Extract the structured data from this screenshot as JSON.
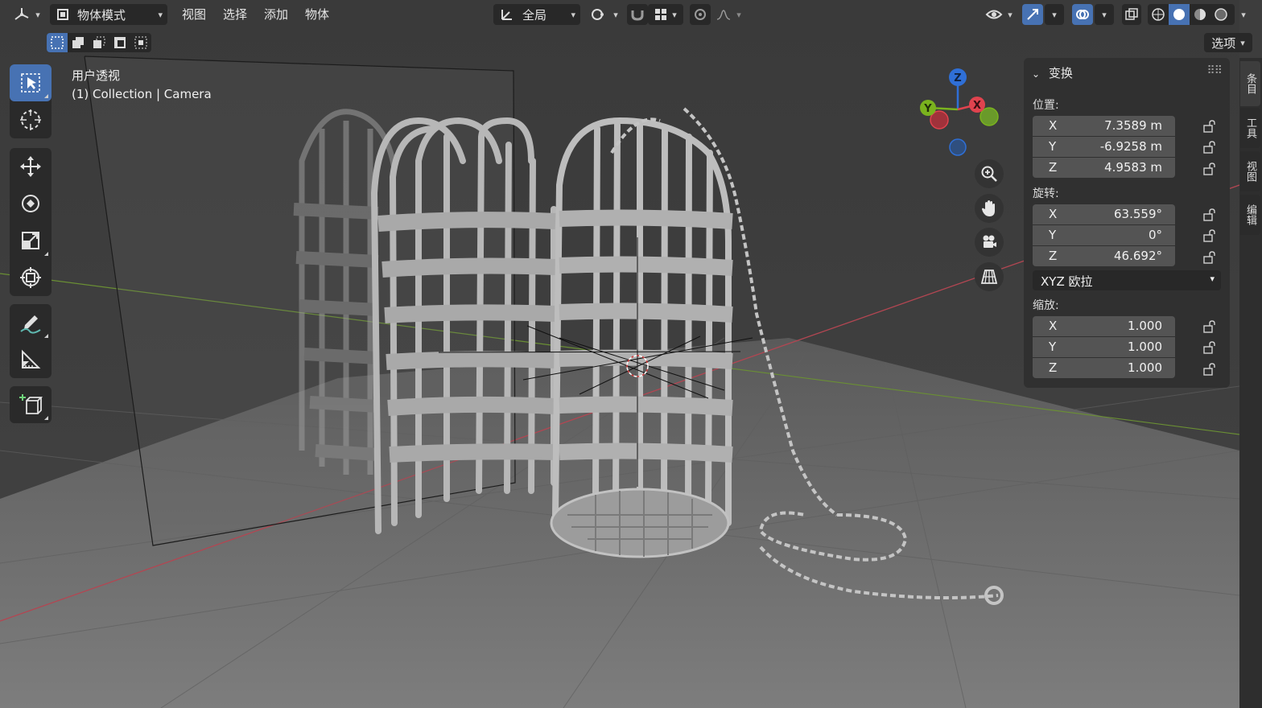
{
  "header": {
    "mode_label": "物体模式",
    "menu": [
      "视图",
      "选择",
      "添加",
      "物体"
    ],
    "transform_orientation": "全局",
    "options_label": "选项"
  },
  "viewport": {
    "view_name": "用户透视",
    "collection_info": "(1) Collection | Camera"
  },
  "gizmo": {
    "z": "Z",
    "y": "Y",
    "x": "X"
  },
  "properties": {
    "title": "变换",
    "location_label": "位置:",
    "location": [
      {
        "axis": "X",
        "value": "7.3589 m"
      },
      {
        "axis": "Y",
        "value": "-6.9258 m"
      },
      {
        "axis": "Z",
        "value": "4.9583 m"
      }
    ],
    "rotation_label": "旋转:",
    "rotation": [
      {
        "axis": "X",
        "value": "63.559°"
      },
      {
        "axis": "Y",
        "value": "0°"
      },
      {
        "axis": "Z",
        "value": "46.692°"
      }
    ],
    "rotation_mode": "XYZ 欧拉",
    "scale_label": "缩放:",
    "scale": [
      {
        "axis": "X",
        "value": "1.000"
      },
      {
        "axis": "Y",
        "value": "1.000"
      },
      {
        "axis": "Z",
        "value": "1.000"
      }
    ]
  },
  "side_tabs": [
    "条目",
    "工具",
    "视图",
    "编辑"
  ],
  "colors": {
    "accent": "#4772b3",
    "axis_x": "#e0434e",
    "axis_y": "#7ab31e",
    "axis_z": "#2f6fd6"
  }
}
